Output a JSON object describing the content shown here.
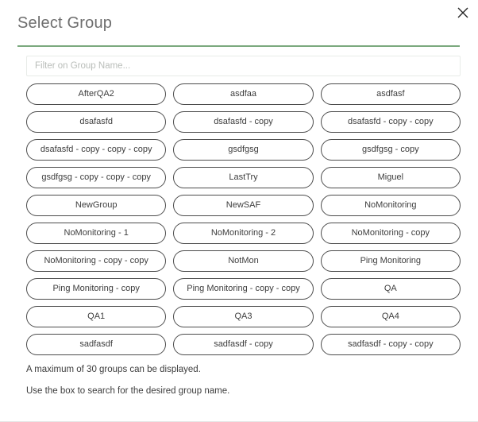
{
  "dialog": {
    "title": "Select Group",
    "close_icon": "close-icon",
    "accent_color": "#7ba97e",
    "border_color": "#4c4c4c"
  },
  "filter": {
    "value": "",
    "placeholder": "Filter on Group Name..."
  },
  "groups": {
    "columns": 3,
    "rows": [
      [
        "AfterQA2",
        "asdfaa",
        "asdfasf"
      ],
      [
        "dsafasfd",
        "dsafasfd - copy",
        "dsafasfd - copy - copy"
      ],
      [
        "dsafasfd - copy - copy - copy",
        "gsdfgsg",
        "gsdfgsg - copy"
      ],
      [
        "gsdfgsg - copy - copy - copy",
        "LastTry",
        "Miguel"
      ],
      [
        "NewGroup",
        "NewSAF",
        "NoMonitoring"
      ],
      [
        "NoMonitoring - 1",
        "NoMonitoring - 2",
        "NoMonitoring - copy"
      ],
      [
        "NoMonitoring - copy - copy",
        "NotMon",
        "Ping Monitoring"
      ],
      [
        "Ping Monitoring - copy",
        "Ping Monitoring - copy - copy",
        "QA"
      ],
      [
        "QA1",
        "QA3",
        "QA4"
      ],
      [
        "sadfasdf",
        "sadfasdf - copy",
        "sadfasdf - copy - copy"
      ]
    ]
  },
  "notes": [
    "A maximum of 30 groups can be displayed.",
    "Use the box to search for the desired group name."
  ]
}
